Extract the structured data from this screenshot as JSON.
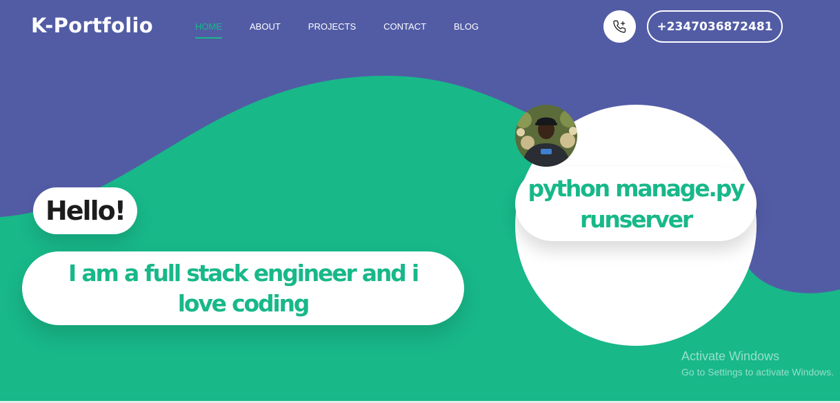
{
  "header": {
    "logo": "K-Portfolio",
    "nav": [
      {
        "label": "HOME",
        "active": true
      },
      {
        "label": "ABOUT",
        "active": false
      },
      {
        "label": "PROJECTS",
        "active": false
      },
      {
        "label": "CONTACT",
        "active": false
      },
      {
        "label": "BLOG",
        "active": false
      }
    ],
    "call_icon": "phone-call-icon",
    "phone_number": "+2347036872481"
  },
  "hero": {
    "greeting": "Hello!",
    "tagline": "I am a full stack engineer and i love coding",
    "code_snippet": "python manage.py runserver",
    "avatar": "profile-photo"
  },
  "watermark": {
    "title": "Activate Windows",
    "subtitle": "Go to Settings to activate Windows."
  },
  "colors": {
    "background": "#525ca5",
    "accent": "#18b889",
    "white": "#ffffff",
    "dark_text": "#1c1c1c"
  }
}
